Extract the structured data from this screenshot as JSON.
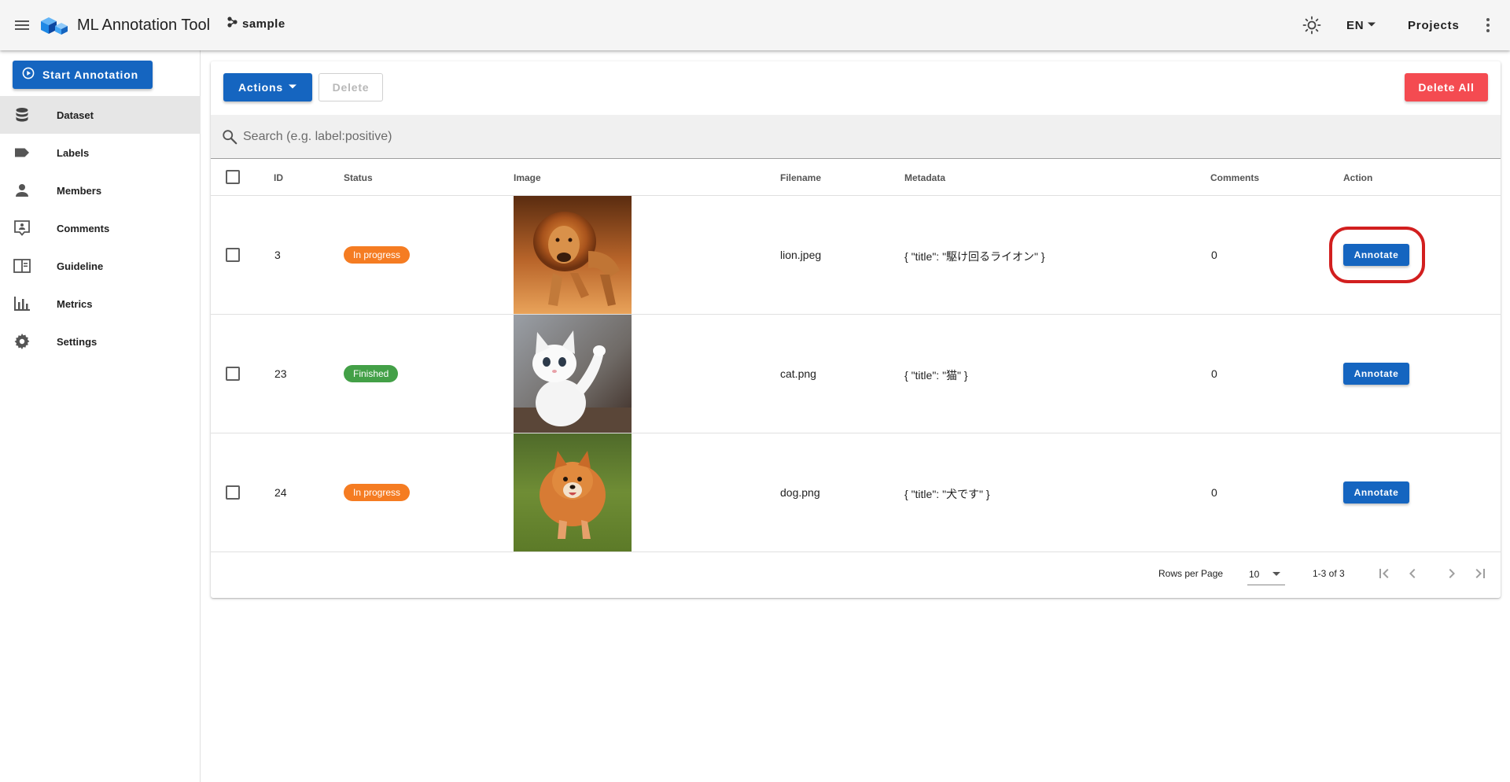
{
  "header": {
    "title": "ML Annotation Tool",
    "project_name": "sample",
    "language": "EN",
    "projects_label": "Projects"
  },
  "sidebar": {
    "start_annotation_label": "Start Annotation",
    "items": [
      {
        "label": "Dataset",
        "icon": "database-icon",
        "active": true
      },
      {
        "label": "Labels",
        "icon": "label-icon",
        "active": false
      },
      {
        "label": "Members",
        "icon": "person-icon",
        "active": false
      },
      {
        "label": "Comments",
        "icon": "comment-icon",
        "active": false
      },
      {
        "label": "Guideline",
        "icon": "book-icon",
        "active": false
      },
      {
        "label": "Metrics",
        "icon": "bar-chart-icon",
        "active": false
      },
      {
        "label": "Settings",
        "icon": "gear-icon",
        "active": false
      }
    ]
  },
  "toolbar": {
    "actions_label": "Actions",
    "delete_label": "Delete",
    "delete_all_label": "Delete All"
  },
  "search": {
    "placeholder": "Search (e.g. label:positive)",
    "value": ""
  },
  "table": {
    "columns": {
      "id": "ID",
      "status": "Status",
      "image": "Image",
      "filename": "Filename",
      "metadata": "Metadata",
      "comments": "Comments",
      "action": "Action"
    },
    "rows": [
      {
        "id": "3",
        "status": "In progress",
        "status_color": "#f57c22",
        "image": "lion",
        "filename": "lion.jpeg",
        "metadata": "{ \"title\": \"駆け回るライオン\" }",
        "comments": "0",
        "action": "Annotate",
        "highlighted": true
      },
      {
        "id": "23",
        "status": "Finished",
        "status_color": "#43a047",
        "image": "cat",
        "filename": "cat.png",
        "metadata": "{ \"title\": \"猫\" }",
        "comments": "0",
        "action": "Annotate",
        "highlighted": false
      },
      {
        "id": "24",
        "status": "In progress",
        "status_color": "#f57c22",
        "image": "dog",
        "filename": "dog.png",
        "metadata": "{ \"title\": \"犬です\" }",
        "comments": "0",
        "action": "Annotate",
        "highlighted": false
      }
    ]
  },
  "pagination": {
    "rows_per_page_label": "Rows per Page",
    "rows_per_page": "10",
    "range": "1-3 of 3"
  },
  "colors": {
    "primary": "#1565c0",
    "danger": "#f44b51",
    "in_progress": "#f57c22",
    "finished": "#43a047",
    "highlight": "#d21f1f"
  }
}
